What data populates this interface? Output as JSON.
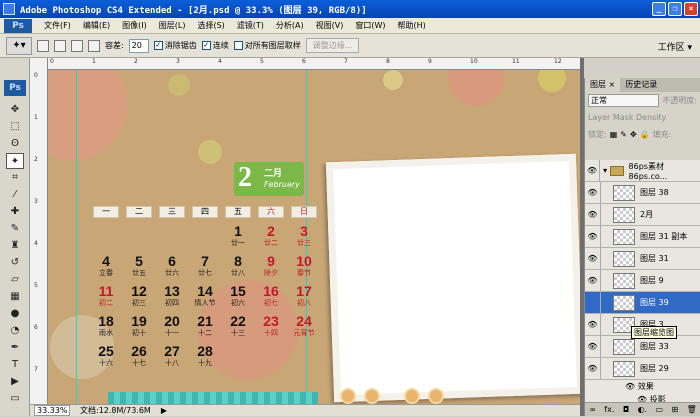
{
  "window": {
    "title": "Adobe Photoshop CS4 Extended - [2月.psd @ 33.3% (图层 39, RGB/8)]",
    "minimize": "_",
    "restore": "❐",
    "close": "×"
  },
  "menubar": {
    "logo": "Ps",
    "items": [
      "文件(F)",
      "编辑(E)",
      "图像(I)",
      "图层(L)",
      "选择(S)",
      "滤镜(T)",
      "分析(A)",
      "视图(V)",
      "窗口(W)",
      "帮助(H)"
    ]
  },
  "options": {
    "tolerance_label": "容差:",
    "tolerance_value": "20",
    "antialias_label": "消除锯齿",
    "contiguous_label": "连续",
    "all_layers_label": "对所有图层取样",
    "refine_edge_label": "调整边缘...",
    "workspace_label": "工作区 ▾"
  },
  "toolbox": {
    "logo": "Ps"
  },
  "rulers": {
    "top": [
      "0",
      "1",
      "2",
      "3",
      "4",
      "5",
      "6",
      "7",
      "8",
      "9",
      "10",
      "11",
      "12"
    ],
    "left": [
      "0",
      "1",
      "2",
      "3",
      "4",
      "5",
      "6",
      "7"
    ]
  },
  "document": {
    "month_number": "2",
    "month_cn": "二月",
    "month_en": "February",
    "weekdays": [
      "一",
      "二",
      "三",
      "四",
      "五",
      "六",
      "日"
    ],
    "days": [
      {
        "d": "",
        "l": "",
        "red": false
      },
      {
        "d": "",
        "l": "",
        "red": false
      },
      {
        "d": "",
        "l": "",
        "red": false
      },
      {
        "d": "",
        "l": "",
        "red": false
      },
      {
        "d": "1",
        "l": "廿一",
        "red": false
      },
      {
        "d": "2",
        "l": "廿二",
        "red": true
      },
      {
        "d": "3",
        "l": "廿三",
        "red": true
      },
      {
        "d": "4",
        "l": "立春",
        "red": false
      },
      {
        "d": "5",
        "l": "廿五",
        "red": false
      },
      {
        "d": "6",
        "l": "廿六",
        "red": false
      },
      {
        "d": "7",
        "l": "廿七",
        "red": false
      },
      {
        "d": "8",
        "l": "廿八",
        "red": false
      },
      {
        "d": "9",
        "l": "除夕",
        "red": true
      },
      {
        "d": "10",
        "l": "春节",
        "red": true
      },
      {
        "d": "11",
        "l": "初二",
        "red": true
      },
      {
        "d": "12",
        "l": "初三",
        "red": false
      },
      {
        "d": "13",
        "l": "初四",
        "red": false
      },
      {
        "d": "14",
        "l": "情人节",
        "red": false
      },
      {
        "d": "15",
        "l": "初六",
        "red": false
      },
      {
        "d": "16",
        "l": "初七",
        "red": true
      },
      {
        "d": "17",
        "l": "初八",
        "red": true
      },
      {
        "d": "18",
        "l": "雨水",
        "red": false
      },
      {
        "d": "19",
        "l": "初十",
        "red": false
      },
      {
        "d": "20",
        "l": "十一",
        "red": false
      },
      {
        "d": "21",
        "l": "十二",
        "red": false
      },
      {
        "d": "22",
        "l": "十三",
        "red": false
      },
      {
        "d": "23",
        "l": "十四",
        "red": true
      },
      {
        "d": "24",
        "l": "元宵节",
        "red": true
      },
      {
        "d": "25",
        "l": "十六",
        "red": false
      },
      {
        "d": "26",
        "l": "十七",
        "red": false
      },
      {
        "d": "27",
        "l": "十八",
        "red": false
      },
      {
        "d": "28",
        "l": "十九",
        "red": false
      }
    ]
  },
  "status": {
    "zoom": "33.33%",
    "doc_info": "文档:12.8M/73.6M"
  },
  "layers_panel": {
    "tabs": [
      "图层 ×",
      "历史记录"
    ],
    "blend_mode": "正常",
    "opacity_label": "不透明度:",
    "mask_density": "Layer Mask Density",
    "lock_label": "锁定:",
    "fill_label": "填充:",
    "group_name": "86ps素材 86ps.co...",
    "layers": [
      {
        "name": "图层 38",
        "selected": false,
        "visible": true
      },
      {
        "name": "2月",
        "selected": false,
        "visible": true
      },
      {
        "name": "图层 31 副本",
        "selected": false,
        "visible": true
      },
      {
        "name": "图层 31",
        "selected": false,
        "visible": true
      },
      {
        "name": "图层 9",
        "selected": false,
        "visible": true
      },
      {
        "name": "图层 39",
        "selected": true,
        "visible": false
      },
      {
        "name": "图层 3",
        "selected": false,
        "visible": true
      },
      {
        "name": "图层 33",
        "selected": false,
        "visible": true
      },
      {
        "name": "图层 29",
        "selected": false,
        "visible": true
      }
    ],
    "tooltip": "图层缩览图",
    "effects_label": "效果",
    "drop_shadow_label": "投影",
    "bottom_icons": [
      "∞",
      "fx.",
      "◘",
      "◐.",
      "▭",
      "⊞",
      "🗑"
    ]
  }
}
